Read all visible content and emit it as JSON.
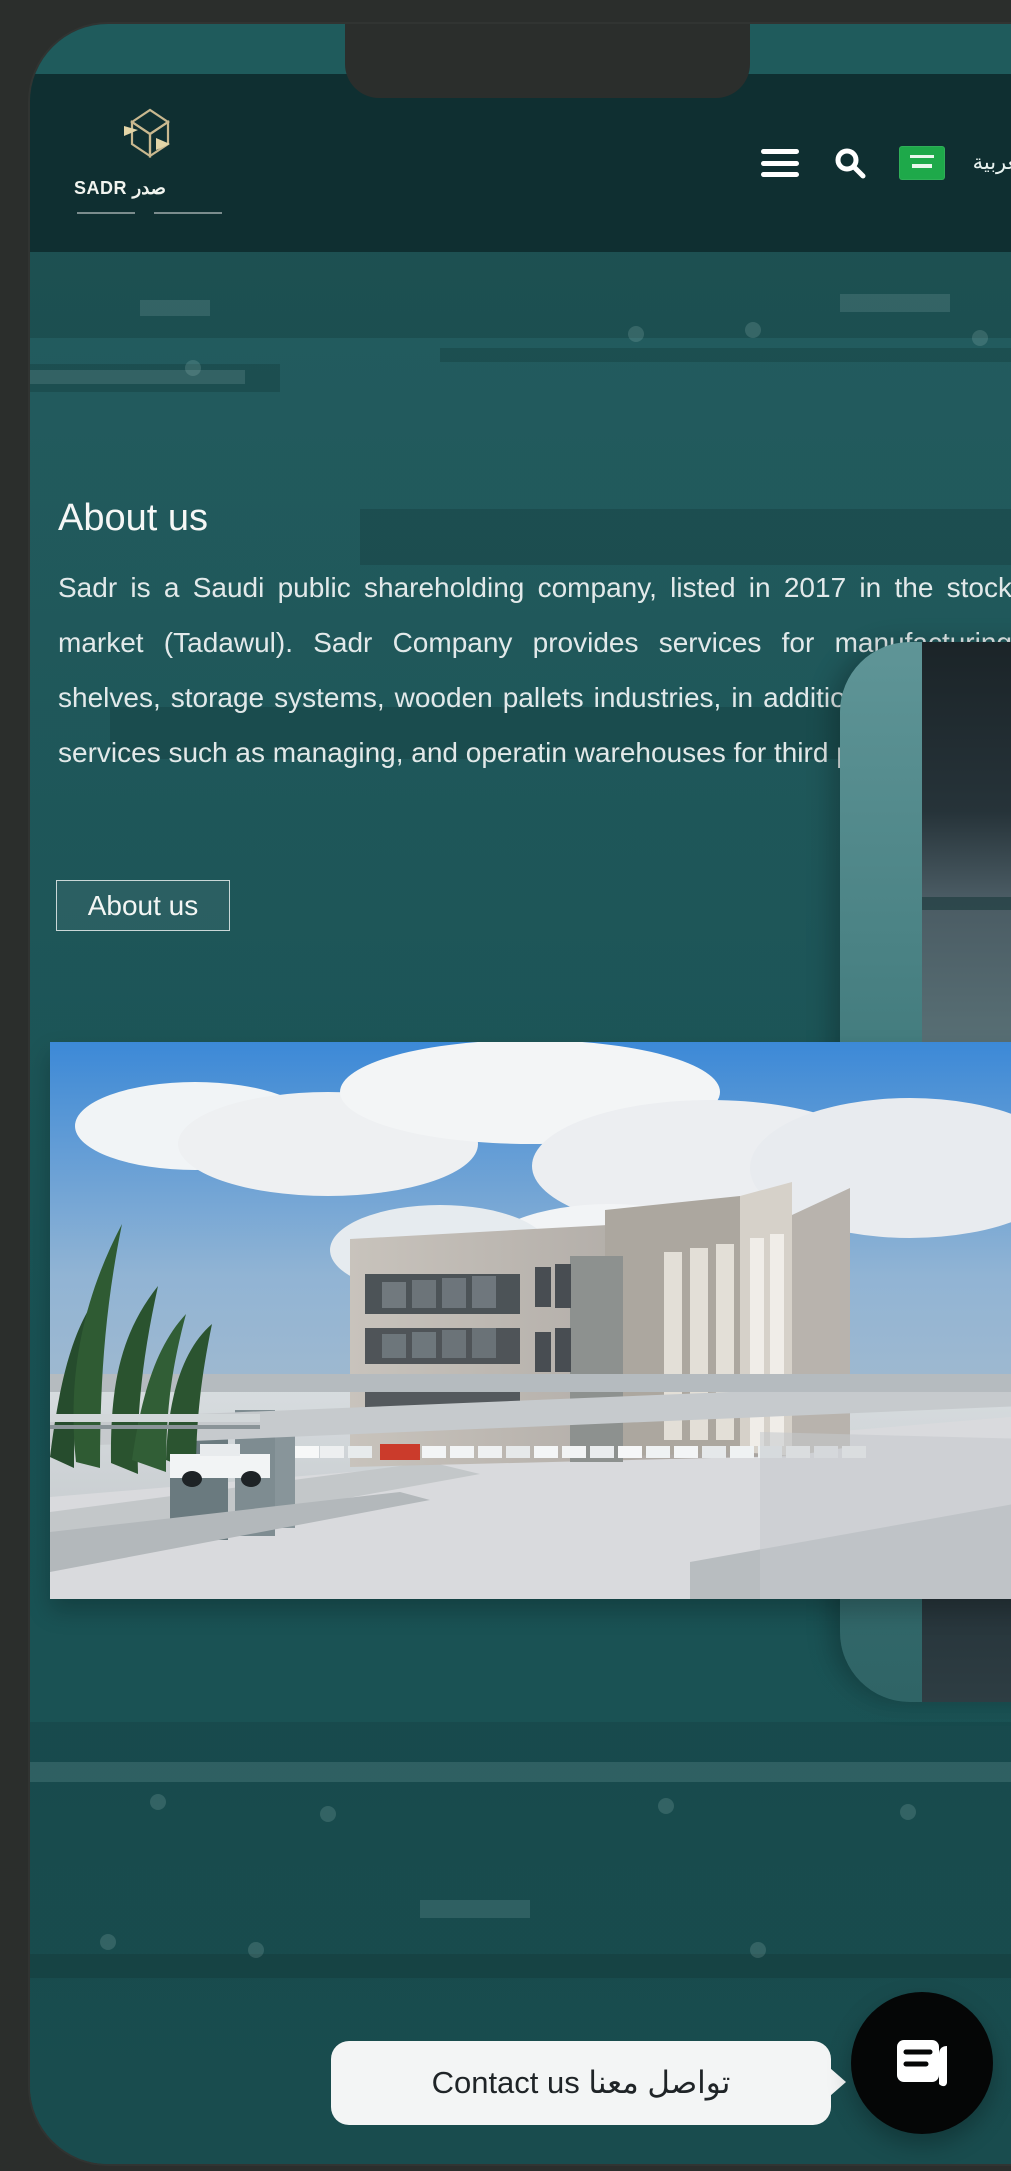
{
  "header": {
    "logo": {
      "name": "SADR صدر"
    },
    "language_label": "العربية",
    "menu_icon": "hamburger-menu-icon",
    "search_icon": "search-icon",
    "flag_icon": "saudi-flag-icon"
  },
  "about": {
    "title": "About us",
    "body": "Sadr is a Saudi public shareholding company, listed in 2017 in the stock market (Tadawul). Sadr Company provides services for manufacturing shelves, storage systems, wooden pallets industries, in addition to logistical services such as managing, and operatin warehouses for third parties.",
    "button_label": "About us"
  },
  "media": {
    "primary_image": "building-exterior-photo",
    "secondary_image": "warehouse-interior-photo"
  },
  "contact": {
    "label": "Contact us تواصل معنا",
    "icon": "chat-icon"
  },
  "colors": {
    "header_bg": "#0f2f31",
    "accent": "#1ea94a",
    "hero_teal": "#245c5f",
    "chat_dark": "#050606"
  }
}
